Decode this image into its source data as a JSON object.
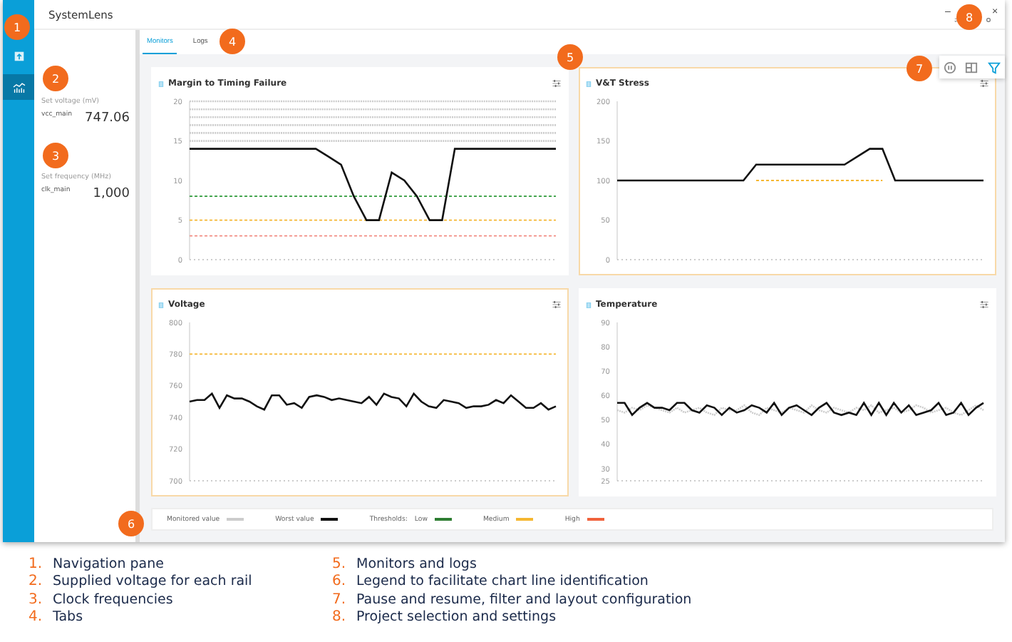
{
  "window": {
    "title": "SystemLens",
    "controls": [
      "–",
      "×"
    ]
  },
  "nav_items": [
    {
      "kind": "upload",
      "selected": false
    },
    {
      "kind": "monitor",
      "selected": true
    }
  ],
  "readouts": [
    {
      "heading": "Set voltage (mV)",
      "name": "vcc_main",
      "value": "747.06"
    },
    {
      "heading": "Set frequency (MHz)",
      "name": "clk_main",
      "value": "1,000"
    }
  ],
  "tabs": [
    {
      "label": "Monitors",
      "selected": true
    },
    {
      "label": "Logs",
      "selected": false
    }
  ],
  "monitors": [
    {
      "title": "Margin to Timing Failure",
      "alert": false,
      "chart_data": {
        "type": "line",
        "ylim": [
          0,
          20
        ],
        "yticks": [
          0,
          5,
          10,
          15,
          20
        ],
        "series": [
          {
            "color": "#cccccc",
            "line_style": "dotted",
            "values": [
              20,
              20,
              20,
              20,
              20,
              20,
              20,
              20,
              20,
              20,
              20,
              20,
              20,
              20,
              20,
              20,
              20,
              20,
              20,
              20,
              20,
              20,
              20,
              20,
              20,
              20,
              20,
              20,
              20,
              20
            ]
          },
          {
            "color": "#cccccc",
            "line_style": "dotted",
            "values": [
              19,
              19,
              19,
              19,
              19,
              19,
              19,
              19,
              19,
              19,
              19,
              19,
              19,
              19,
              19,
              19,
              19,
              19,
              19,
              19,
              19,
              19,
              19,
              19,
              19,
              19,
              19,
              19,
              19,
              19
            ]
          },
          {
            "color": "#cccccc",
            "line_style": "dotted",
            "values": [
              18,
              18,
              18,
              18,
              18,
              18,
              18,
              18,
              18,
              18,
              18,
              18,
              18,
              18,
              18,
              18,
              18,
              18,
              18,
              18,
              18,
              18,
              18,
              18,
              18,
              18,
              18,
              18,
              18,
              18
            ]
          },
          {
            "color": "#cccccc",
            "line_style": "dotted",
            "values": [
              17,
              17,
              17,
              17,
              17,
              17,
              17,
              17,
              17,
              17,
              17,
              17,
              17,
              17,
              17,
              17,
              17,
              17,
              17,
              17,
              17,
              17,
              17,
              17,
              17,
              17,
              17,
              17,
              17,
              17
            ]
          },
          {
            "color": "#cccccc",
            "line_style": "dotted",
            "values": [
              16,
              16,
              16,
              16,
              16,
              16,
              16,
              16,
              16,
              16,
              16,
              16,
              16,
              16,
              16,
              16,
              16,
              16,
              16,
              16,
              16,
              16,
              16,
              16,
              16,
              16,
              16,
              16,
              16,
              16
            ]
          },
          {
            "color": "#cccccc",
            "line_style": "dotted",
            "values": [
              15,
              15,
              15,
              15,
              15,
              15,
              15,
              15,
              15,
              15,
              15,
              15,
              15,
              15,
              15,
              15,
              15,
              15,
              15,
              15,
              15,
              15,
              15,
              15,
              15,
              15,
              15,
              15,
              15,
              15
            ]
          },
          {
            "color": "#2e9a3a",
            "line_style": "dashed",
            "values": [
              8,
              8,
              8,
              8,
              8,
              8,
              8,
              8,
              8,
              8,
              8,
              8,
              8,
              8,
              8,
              8,
              8,
              8,
              8,
              8,
              8,
              8,
              8,
              8,
              8,
              8,
              8,
              8,
              8,
              8
            ]
          },
          {
            "color": "#f5b731",
            "line_style": "dashed",
            "values": [
              5,
              5,
              5,
              5,
              5,
              5,
              5,
              5,
              5,
              5,
              5,
              5,
              5,
              5,
              5,
              5,
              5,
              5,
              5,
              5,
              5,
              5,
              5,
              5,
              5,
              5,
              5,
              5,
              5,
              5
            ]
          },
          {
            "color": "#f28b82",
            "line_style": "dashed",
            "values": [
              3,
              3,
              3,
              3,
              3,
              3,
              3,
              3,
              3,
              3,
              3,
              3,
              3,
              3,
              3,
              3,
              3,
              3,
              3,
              3,
              3,
              3,
              3,
              3,
              3,
              3,
              3,
              3,
              3,
              3
            ]
          },
          {
            "color": "#111111",
            "line_style": "solid",
            "values": [
              14,
              14,
              14,
              14,
              14,
              14,
              14,
              14,
              14,
              14,
              14,
              13,
              12,
              8,
              5,
              5,
              11,
              10,
              8,
              5,
              5,
              14,
              14,
              14,
              14,
              14,
              14,
              14,
              14,
              14
            ]
          }
        ]
      }
    },
    {
      "title": "V&T Stress",
      "alert": true,
      "chart_data": {
        "type": "line",
        "ylim": [
          0,
          200
        ],
        "yticks": [
          0,
          50,
          100,
          150,
          200
        ],
        "series": [
          {
            "color": "#f5b731",
            "line_style": "dashed",
            "values": [
              null,
              null,
              null,
              null,
              null,
              null,
              null,
              null,
              null,
              null,
              null,
              100,
              100,
              100,
              100,
              100,
              100,
              100,
              100,
              100,
              100,
              100,
              null,
              null,
              null,
              null,
              null,
              null,
              null,
              null
            ]
          },
          {
            "color": "#111111",
            "line_style": "solid",
            "values": [
              100,
              100,
              100,
              100,
              100,
              100,
              100,
              100,
              100,
              100,
              100,
              120,
              120,
              120,
              120,
              120,
              120,
              120,
              120,
              130,
              140,
              140,
              100,
              100,
              100,
              100,
              100,
              100,
              100,
              100
            ]
          }
        ]
      }
    },
    {
      "title": "Voltage",
      "alert": true,
      "chart_data": {
        "type": "line",
        "ylim": [
          700,
          800
        ],
        "yticks": [
          700,
          720,
          740,
          760,
          780,
          800
        ],
        "series": [
          {
            "color": "#f5b731",
            "line_style": "dashed",
            "values": [
              780,
              780,
              780,
              780,
              780,
              780,
              780,
              780,
              780,
              780,
              780,
              780,
              780,
              780,
              780,
              780,
              780,
              780,
              780,
              780,
              780,
              780,
              780,
              780,
              780,
              780,
              780,
              780,
              780,
              780,
              780,
              780,
              780,
              780,
              780,
              780,
              780,
              780,
              780,
              780,
              780,
              780,
              780,
              780,
              780,
              780,
              780,
              780,
              780,
              780
            ]
          },
          {
            "color": "#111111",
            "line_style": "solid",
            "values": [
              750,
              751,
              751,
              755,
              746,
              754,
              752,
              752,
              750,
              747,
              745,
              754,
              754,
              748,
              749,
              746,
              753,
              754,
              753,
              751,
              752,
              751,
              750,
              749,
              753,
              748,
              755,
              753,
              752,
              747,
              755,
              750,
              747,
              746,
              751,
              750,
              749,
              746,
              747,
              747,
              748,
              751,
              749,
              754,
              750,
              746,
              746,
              749,
              745,
              747
            ]
          }
        ]
      }
    },
    {
      "title": "Temperature",
      "alert": false,
      "chart_data": {
        "type": "line",
        "ylim": [
          25,
          90
        ],
        "yticks": [
          25,
          30,
          40,
          50,
          60,
          70,
          80,
          90
        ],
        "series": [
          {
            "color": "#cccccc",
            "line_style": "dotted",
            "values": [
              54,
              53,
              55,
              54,
              56,
              55,
              54,
              53,
              55,
              53,
              54,
              55,
              53,
              52,
              55,
              54,
              54,
              56,
              53,
              52,
              55,
              54,
              53,
              55,
              54,
              53,
              56,
              54,
              53,
              55,
              54,
              53,
              55,
              54,
              56,
              53,
              54,
              55,
              53,
              54,
              56,
              55,
              53,
              54,
              55,
              53,
              52,
              54,
              56,
              54
            ]
          },
          {
            "color": "#111111",
            "line_style": "solid",
            "values": [
              57,
              57,
              52,
              55,
              57,
              55,
              55,
              54,
              57,
              57,
              54,
              53,
              56,
              55,
              52,
              55,
              53,
              54,
              56,
              55,
              53,
              57,
              52,
              55,
              56,
              54,
              52,
              55,
              57,
              53,
              52,
              53,
              52,
              57,
              52,
              57,
              52,
              57,
              53,
              56,
              52,
              53,
              54,
              57,
              52,
              53,
              57,
              52,
              55,
              57
            ]
          }
        ]
      }
    }
  ],
  "legend": {
    "series": [
      {
        "label": "Monitored value",
        "color": "#cccccc"
      },
      {
        "label": "Worst value",
        "color": "#111111"
      }
    ],
    "thresholds_label": "Thresholds:",
    "thresholds": [
      {
        "label": "Low",
        "color": "#2e7d32"
      },
      {
        "label": "Medium",
        "color": "#f5b731"
      },
      {
        "label": "High",
        "color": "#f0623c"
      }
    ]
  },
  "callouts": [
    "1",
    "2",
    "3",
    "4",
    "5",
    "6",
    "7",
    "8"
  ],
  "caption": [
    {
      "number": "1.",
      "text": "Navigation pane"
    },
    {
      "number": "2.",
      "text": "Supplied voltage for each rail"
    },
    {
      "number": "3.",
      "text": "Clock frequencies"
    },
    {
      "number": "4.",
      "text": "Tabs"
    },
    {
      "number": "5.",
      "text": "Monitors and logs"
    },
    {
      "number": "6.",
      "text": "Legend to facilitate chart line identification"
    },
    {
      "number": "7.",
      "text": "Pause and resume, filter and layout configuration"
    },
    {
      "number": "8.",
      "text": "Project selection and settings"
    }
  ]
}
